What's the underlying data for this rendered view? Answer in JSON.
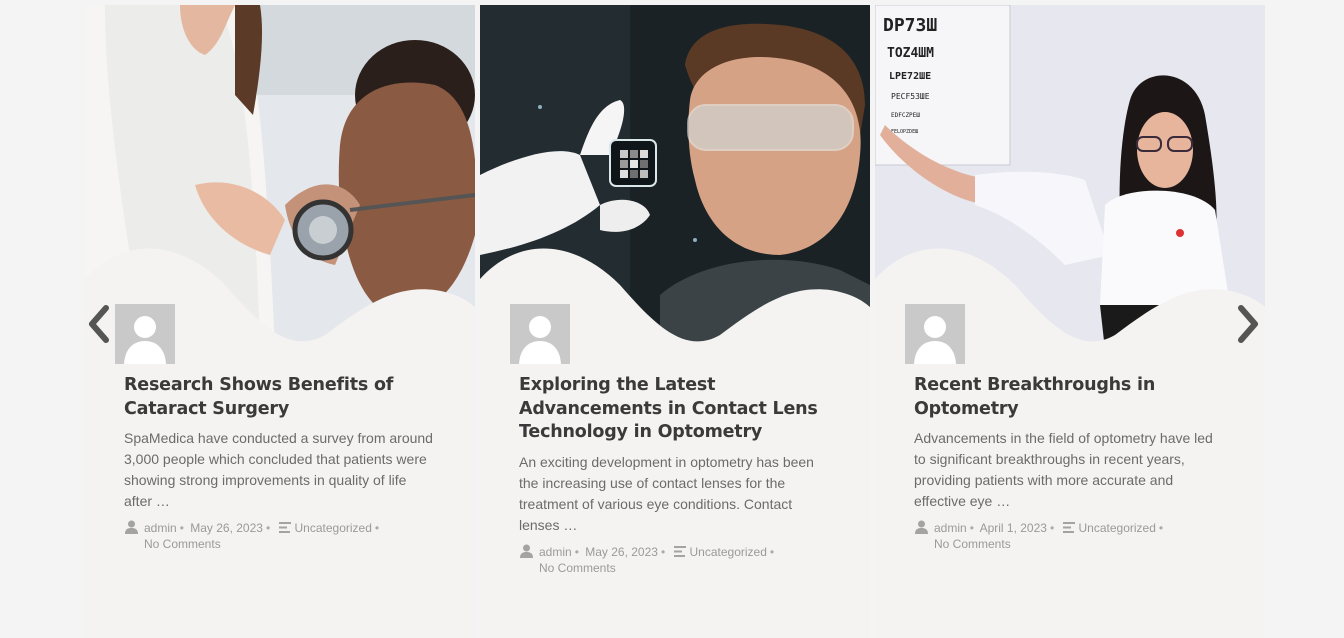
{
  "carousel": {
    "prev_icon": "chevron-left-icon",
    "next_icon": "chevron-right-icon",
    "posts": [
      {
        "title": "Research Shows Benefits of Cataract Surgery",
        "excerpt": "SpaMedica have conducted a survey from around 3,000 people which concluded that patients were showing strong improvements in quality of life after …",
        "author": "admin",
        "date": "May 26, 2023",
        "category": "Uncategorized",
        "comments": "No Comments"
      },
      {
        "title": "Exploring the Latest Advancements in Contact Lens Technology in Optometry",
        "excerpt": "An exciting development in optometry has been the increasing use of contact lenses for the treatment of various eye conditions. Contact lenses …",
        "author": "admin",
        "date": "May 26, 2023",
        "category": "Uncategorized",
        "comments": "No Comments"
      },
      {
        "title": "Recent Breakthroughs in Optometry",
        "excerpt": "Advancements in the field of optometry have led to significant breakthroughs in recent years, providing patients with more accurate and effective eye …",
        "author": "admin",
        "date": "April 1, 2023",
        "category": "Uncategorized",
        "comments": "No Comments"
      }
    ]
  },
  "colors": {
    "card_background": "#f4f3f1",
    "title": "#3a3a3a",
    "excerpt": "#6b6b6b",
    "meta": "#9a9a9a",
    "arrow": "#555555"
  }
}
